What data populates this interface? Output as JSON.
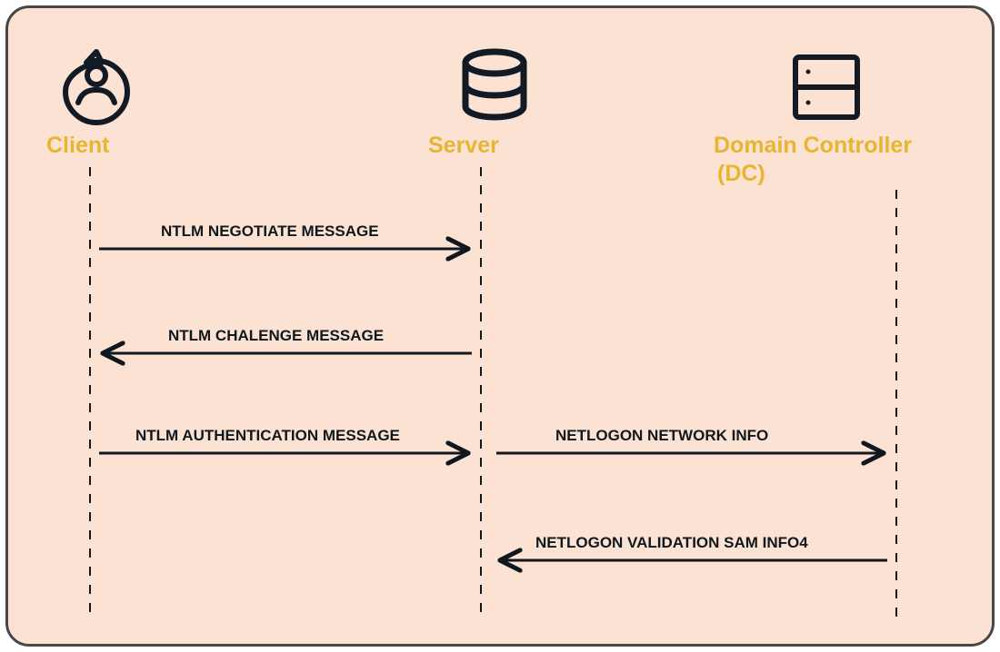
{
  "actors": {
    "client": "Client",
    "server": "Server",
    "dc_line1": "Domain Controller",
    "dc_line2": "(DC)"
  },
  "messages": {
    "m1": "NTLM NEGOTIATE MESSAGE",
    "m2": "NTLM CHALENGE MESSAGE",
    "m3": "NTLM AUTHENTICATION MESSAGE",
    "m4": "NETLOGON NETWORK INFO",
    "m5": "NETLOGON VALIDATION SAM INFO4"
  },
  "colors": {
    "icon": "#121A26",
    "arrow": "#0F181E",
    "label": "#E6B531",
    "bg": "#FCE2D3"
  }
}
